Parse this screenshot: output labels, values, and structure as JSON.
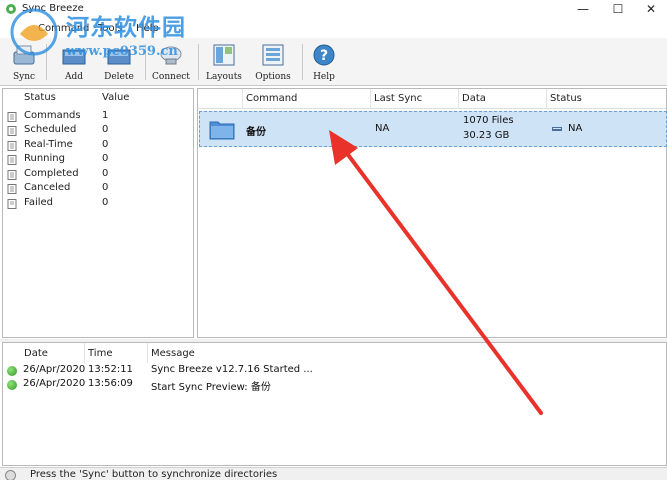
{
  "window": {
    "title": "Sync Breeze",
    "minimize": "—",
    "maximize": "☐",
    "close": "✕"
  },
  "watermark": {
    "text": "河东软件园",
    "url": "www.pc0359.cn"
  },
  "menu": {
    "items": [
      "Command",
      "Tools",
      "Help"
    ]
  },
  "toolbar": {
    "buttons": [
      {
        "label": "Sync",
        "icon": "sync-icon"
      },
      {
        "label": "Add",
        "icon": "add-icon"
      },
      {
        "label": "Delete",
        "icon": "delete-icon"
      },
      {
        "label": "Connect",
        "icon": "connect-icon"
      },
      {
        "label": "Layouts",
        "icon": "layouts-icon"
      },
      {
        "label": "Options",
        "icon": "options-icon"
      },
      {
        "label": "Help",
        "icon": "help-icon"
      }
    ]
  },
  "stats": {
    "headers": {
      "status": "Status",
      "value": "Value"
    },
    "rows": [
      {
        "name": "Commands",
        "value": "1"
      },
      {
        "name": "Scheduled",
        "value": "0"
      },
      {
        "name": "Real-Time",
        "value": "0"
      },
      {
        "name": "Running",
        "value": "0"
      },
      {
        "name": "Completed",
        "value": "0"
      },
      {
        "name": "Canceled",
        "value": "0"
      },
      {
        "name": "Failed",
        "value": "0"
      }
    ]
  },
  "commands": {
    "headers": {
      "command": "Command",
      "last_sync": "Last Sync",
      "data": "Data",
      "status": "Status"
    },
    "rows": [
      {
        "name": "备份",
        "last_sync": "NA",
        "files": "1070 Files",
        "size": "30.23 GB",
        "status": "NA"
      }
    ]
  },
  "log": {
    "headers": {
      "date": "Date",
      "time": "Time",
      "message": "Message"
    },
    "rows": [
      {
        "date": "26/Apr/2020",
        "time": "13:52:11",
        "message": "Sync Breeze v12.7.16 Started ..."
      },
      {
        "date": "26/Apr/2020",
        "time": "13:56:09",
        "message": "Start Sync Preview: 备份"
      }
    ]
  },
  "statusbar": {
    "text": "Press the 'Sync' button to synchronize directories"
  },
  "colors": {
    "selection": "#cfe3f7",
    "arrow": "#e8322a",
    "watermark": "#2d8fe0",
    "success_dot": "#2f9a22"
  }
}
